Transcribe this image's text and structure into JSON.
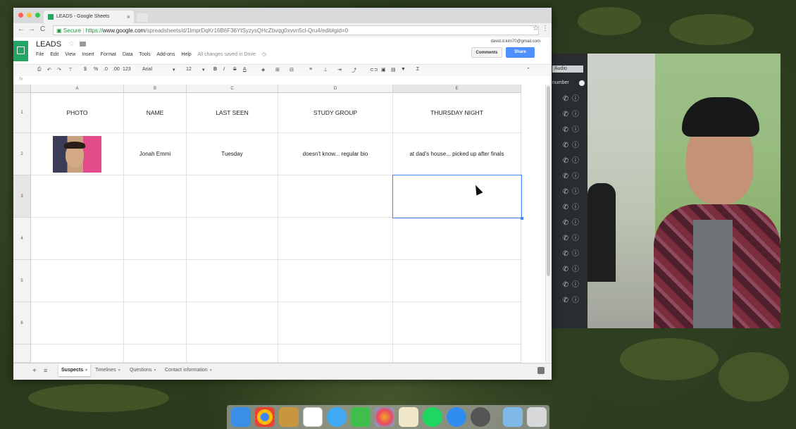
{
  "browser": {
    "tab_title": "LEADS - Google Sheets",
    "url_secure": "Secure",
    "url_scheme": "https://",
    "url_host": "www.google.com",
    "url_path": "/spreadsheets/d/1lmprDqKr16B6F36YtSyzysQHcZbvqg0xvvn5cl-Qru4/edit#gid=0"
  },
  "sheets": {
    "doc_title": "LEADS",
    "menu": [
      "File",
      "Edit",
      "View",
      "Insert",
      "Format",
      "Data",
      "Tools",
      "Add-ons",
      "Help"
    ],
    "save_status": "All changes saved in Drive",
    "user_email": "david.d.kim70@gmail.com",
    "comments_label": "Comments",
    "share_label": "Share",
    "toolbar": {
      "zoom": "123",
      "font": "Arial",
      "font_size": "12",
      "bold": "B",
      "italic": "I",
      "strike": "S",
      "text_color": "A"
    },
    "fx_label": "fx",
    "columns": [
      "A",
      "B",
      "C",
      "D",
      "E"
    ],
    "rows": [
      "1",
      "2",
      "3",
      "4",
      "5",
      "6"
    ],
    "header_row": [
      "PHOTO",
      "NAME",
      "LAST SEEN",
      "STUDY GROUP",
      "THURSDAY NIGHT"
    ],
    "data_row": [
      "",
      "Jonah Emmi",
      "Tuesday",
      "doesn't know... regular bio",
      "at dad's house... picked up after finals"
    ],
    "sheet_tabs": [
      "Suspects",
      "Timelines",
      "Questions",
      "Contact information"
    ],
    "active_tab": "Suspects"
  },
  "video": {
    "audio_label": "Audio",
    "number_label": "number"
  },
  "colors": {
    "sheets_green": "#23a566",
    "share_blue": "#4d90fe",
    "selection_blue": "#4285f4"
  }
}
